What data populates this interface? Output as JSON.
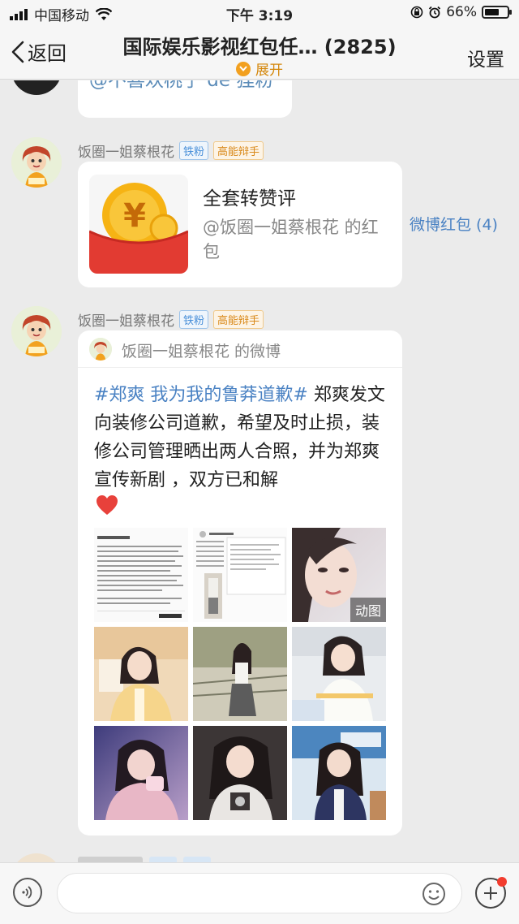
{
  "status_bar": {
    "carrier": "中国移动",
    "time": "下午 3:19",
    "battery": "66%",
    "battery_level": 0.66,
    "icons": [
      "signal-icon",
      "wifi-icon",
      "lock-rotation-icon",
      "alarm-icon",
      "battery-icon"
    ]
  },
  "nav": {
    "back_label": "返回",
    "title": "国际娱乐影视红包任…  (2825)",
    "expand_label": "展开",
    "settings_label": "设置"
  },
  "messages": {
    "previous": {
      "mention_text": "@不喜欢桃子 de 狸粉"
    },
    "red_packet": {
      "sender_name": "饭圈一姐蔡根花",
      "tag_1": "铁粉",
      "tag_2": "高能辩手",
      "title": "全套转赞评",
      "subtitle": "@饭圈一姐蔡根花 的红包",
      "count_label": "微博红包 (4)"
    },
    "weibo_share": {
      "sender_name": "饭圈一姐蔡根花",
      "tag_1": "铁粉",
      "tag_2": "高能辩手",
      "header": "饭圈一姐蔡根花 的微博",
      "topic": "#郑爽 我为我的鲁莽道歉#",
      "body": " 郑爽发文向装修公司道歉，希望及时止损，装修公司管理晒出两人合照，并为郑爽宣传新剧 ，双方已和解",
      "gif_badge": "动图",
      "images": [
        {
          "kind": "doc-screenshot"
        },
        {
          "kind": "doc-screenshot-photo"
        },
        {
          "kind": "portrait-gif"
        },
        {
          "kind": "photo-yellow"
        },
        {
          "kind": "photo-street"
        },
        {
          "kind": "photo-white"
        },
        {
          "kind": "photo-purple"
        },
        {
          "kind": "photo-dark"
        },
        {
          "kind": "photo-blue"
        }
      ]
    }
  },
  "colors": {
    "link_blue": "#4a82c3",
    "mention_blue": "#5a8bb8",
    "expand_orange": "#d4870b",
    "chat_bg": "#ebebeb",
    "red_packet_red": "#e23b32",
    "coin_gold": "#f6b314"
  }
}
